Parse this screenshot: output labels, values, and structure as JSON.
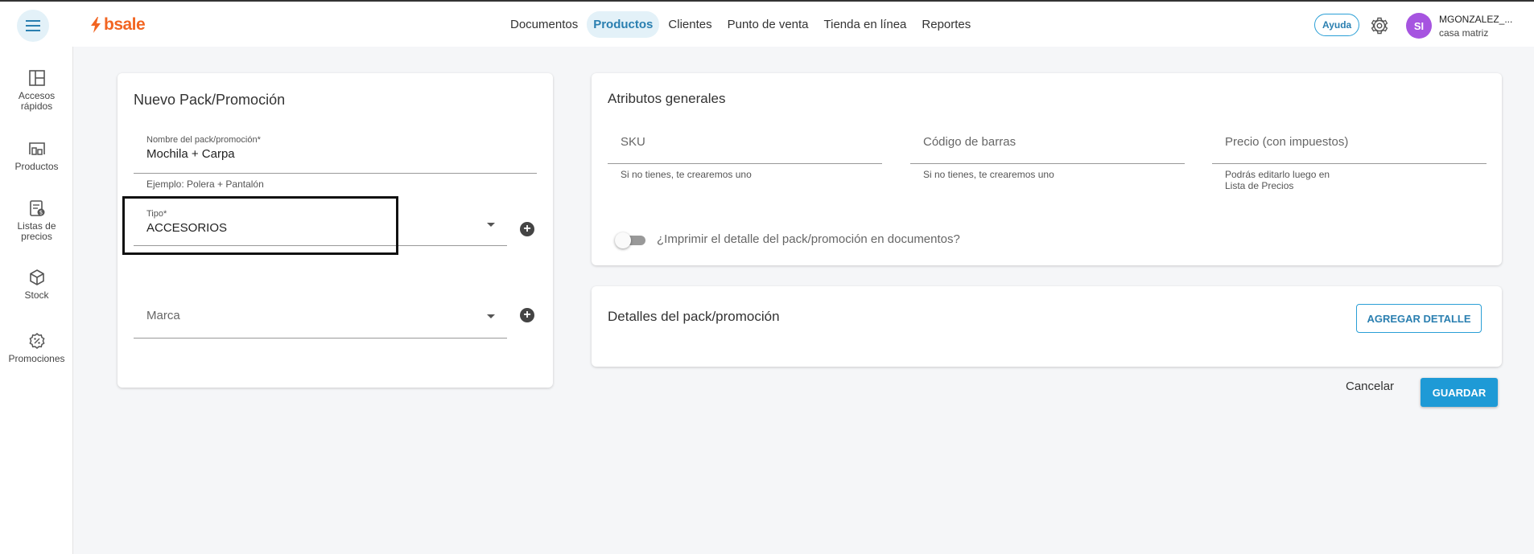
{
  "brand": {
    "logo_text": "bsale",
    "accent": "#f26522",
    "primary": "#1e9ad6"
  },
  "header": {
    "nav": [
      "Documentos",
      "Productos",
      "Clientes",
      "Punto de venta",
      "Tienda en línea",
      "Reportes"
    ],
    "active_nav": "Productos",
    "help_label": "Ayuda",
    "avatar_initials": "SI",
    "user_name": "MGONZALEZ_...",
    "user_branch": "casa matriz"
  },
  "sidebar": {
    "items": [
      {
        "label": "Accesos rápidos",
        "icon": "layout-icon"
      },
      {
        "label": "Productos",
        "icon": "products-icon"
      },
      {
        "label": "Listas de precios",
        "icon": "price-list-icon"
      },
      {
        "label": "Stock",
        "icon": "box-icon"
      },
      {
        "label": "Promociones",
        "icon": "promo-icon"
      }
    ]
  },
  "pack_card": {
    "title": "Nuevo Pack/Promoción",
    "name_label": "Nombre del pack/promoción*",
    "name_value": "Mochila + Carpa",
    "name_hint": "Ejemplo: Polera + Pantalón",
    "type_label": "Tipo*",
    "type_value": "ACCESORIOS",
    "brand_placeholder": "Marca"
  },
  "attributes_card": {
    "title": "Atributos generales",
    "sku_placeholder": "SKU",
    "sku_hint": "Si no tienes, te crearemos uno",
    "barcode_placeholder": "Código de barras",
    "barcode_hint": "Si no tienes, te crearemos uno",
    "price_placeholder": "Precio (con impuestos)",
    "price_hint_1": "Podrás editarlo luego en",
    "price_hint_2": "Lista de Precios",
    "print_toggle_label": "¿Imprimir el detalle del pack/promoción en documentos?"
  },
  "details_card": {
    "title": "Detalles del pack/promoción",
    "add_button": "AGREGAR DETALLE"
  },
  "actions": {
    "cancel": "Cancelar",
    "save": "GUARDAR"
  }
}
